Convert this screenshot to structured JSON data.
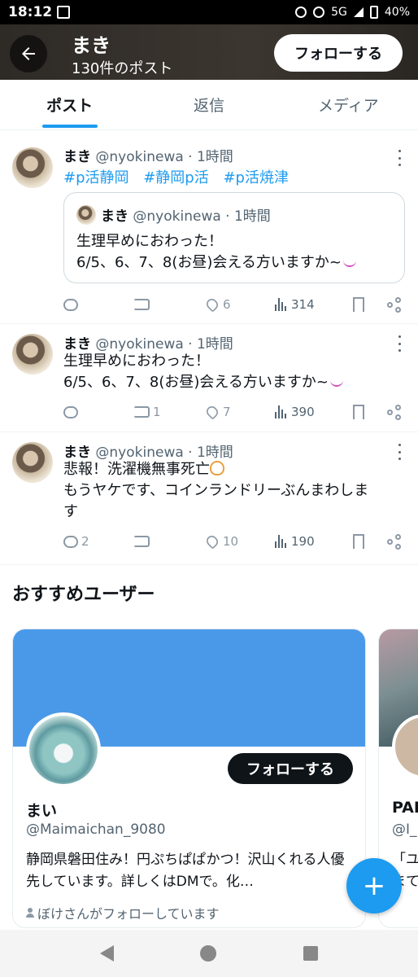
{
  "status_bar": {
    "time": "18:12",
    "network": "5G",
    "battery": "40%"
  },
  "header": {
    "name": "まき",
    "post_count": "130件のポスト",
    "follow_label": "フォローする"
  },
  "tabs": [
    {
      "label": "ポスト",
      "active": true
    },
    {
      "label": "返信",
      "active": false
    },
    {
      "label": "メディア",
      "active": false
    }
  ],
  "tweets": [
    {
      "name": "まき",
      "handle": "@nyokinewa",
      "time": "· 1時間",
      "hashtags": "#p活静岡 #静岡p活 #p活焼津",
      "quote": {
        "name": "まき",
        "handle": "@nyokinewa",
        "time": "· 1時間",
        "text_line1": "生理早めにおわった！",
        "text_line2": "6/5、6、7、8(お昼)会える方いますか~"
      },
      "replies": "",
      "retweets": "",
      "likes": "6",
      "views": "314"
    },
    {
      "name": "まき",
      "handle": "@nyokinewa",
      "time": "· 1時間",
      "text_line1": "生理早めにおわった！",
      "text_line2": "6/5、6、7、8(お昼)会える方いますか~",
      "replies": "",
      "retweets": "1",
      "likes": "7",
      "views": "390"
    },
    {
      "name": "まき",
      "handle": "@nyokinewa",
      "time": "· 1時間",
      "text_line1": "悲報！洗濯機無事死亡",
      "text_line2": "もうヤケです、コインランドリーぶんまわしま\nす",
      "replies": "2",
      "retweets": "",
      "likes": "10",
      "views": "190"
    }
  ],
  "suggestions": {
    "title": "おすすめユーザー",
    "cards": [
      {
        "name": "まい",
        "handle": "@Maimaichan_9080",
        "bio": "静岡県磐田住み！円ぷちぱぱかつ！沢山くれる人優先しています。詳しくはDMで。化…",
        "followed_by": "ぼけさんがフォローしています",
        "follow_label": "フォローする"
      },
      {
        "name": "PAR",
        "handle": "@I_",
        "bio": "「ユ\nまて"
      }
    ]
  },
  "fab_label": "+",
  "colors": {
    "accent": "#1d9bf0",
    "banner": "#4a99e9"
  }
}
